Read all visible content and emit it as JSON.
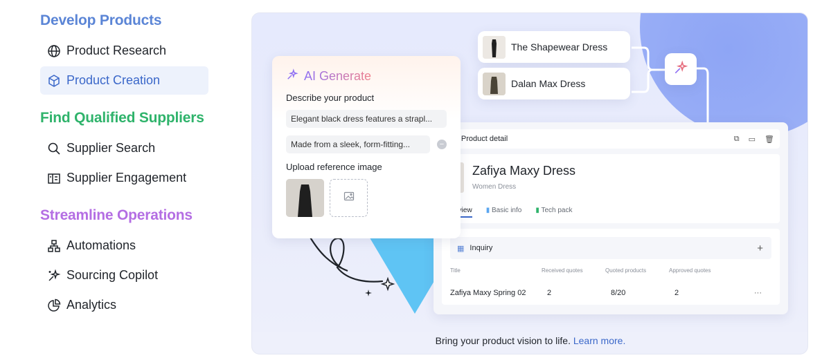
{
  "sidebar": {
    "sections": [
      {
        "title": "Develop Products",
        "color": "#5b85d6",
        "items": [
          {
            "label": "Product Research",
            "icon": "globe-icon",
            "active": false
          },
          {
            "label": "Product Creation",
            "icon": "cube-icon",
            "active": true
          }
        ]
      },
      {
        "title": "Find Qualified Suppliers",
        "color": "#2fb36b",
        "items": [
          {
            "label": "Supplier Search",
            "icon": "search-icon",
            "active": false
          },
          {
            "label": "Supplier Engagement",
            "icon": "building-icon",
            "active": false
          }
        ]
      },
      {
        "title": "Streamline Operations",
        "color": "#b46ee3",
        "items": [
          {
            "label": "Automations",
            "icon": "flow-icon",
            "active": false
          },
          {
            "label": "Sourcing Copilot",
            "icon": "sparkle-icon",
            "active": false
          },
          {
            "label": "Analytics",
            "icon": "pie-chart-icon",
            "active": false
          }
        ]
      }
    ]
  },
  "showcase": {
    "sources": [
      "The Shapewear Dress",
      "Dalan Max Dress"
    ],
    "ai": {
      "title": "AI Generate",
      "describe_label": "Describe your product",
      "field1": "Elegant black dress features a strapl...",
      "field2": "Made from a sleek, form-fitting...",
      "upload_label": "Upload reference image"
    },
    "detail": {
      "bar_title": "Product detail",
      "name": "Zafiya Maxy Dress",
      "category": "Women Dress",
      "tabs": [
        "Overview",
        "Basic info",
        "Tech pack"
      ],
      "inquiry_title": "Inquiry",
      "columns": [
        "Title",
        "Received quotes",
        "Quoted products",
        "Approved quotes"
      ],
      "row": {
        "title": "Zafiya Maxy Spring 02",
        "received": "2",
        "quoted": "8/20",
        "approved": "2"
      }
    },
    "caption": "Bring your product vision to life.",
    "caption_link": "Learn more."
  }
}
